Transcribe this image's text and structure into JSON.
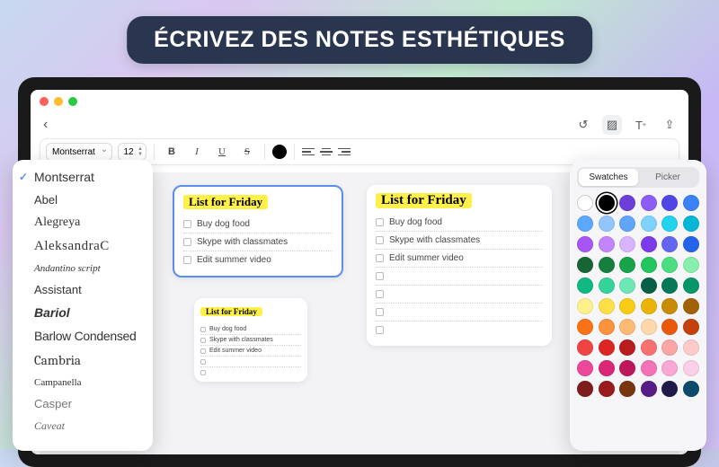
{
  "hero": "ÉCRIVEZ DES NOTES ESTHÉTIQUES",
  "toolbar": {
    "font": "Montserrat",
    "size": "12"
  },
  "fonts": [
    "Montserrat",
    "Abel",
    "Alegreya",
    "AleksandraC",
    "Andantino script",
    "Assistant",
    "Bariol",
    "Barlow Condensed",
    "Cambria",
    "Campanella",
    "Casper",
    "Caveat"
  ],
  "note": {
    "title": "List for Friday",
    "items": [
      "Buy dog food",
      "Skype with classmates",
      "Edit summer video"
    ]
  },
  "picker": {
    "tabs": [
      "Swatches",
      "Picker"
    ],
    "colors": [
      "#ffffff",
      "#000000",
      "#6b3fd9",
      "#8b5cf6",
      "#4f46e5",
      "#3b82f6",
      "#5ba8ff",
      "#93c5fd",
      "#60a5fa",
      "#7dd3fc",
      "#22d3ee",
      "#06b6d4",
      "#a855f7",
      "#c084fc",
      "#d8b4fe",
      "#7c3aed",
      "#6366f1",
      "#2563eb",
      "#166534",
      "#15803d",
      "#16a34a",
      "#22c55e",
      "#4ade80",
      "#86efac",
      "#10b981",
      "#34d399",
      "#6ee7b7",
      "#065f46",
      "#047857",
      "#059669",
      "#fef08a",
      "#fde047",
      "#facc15",
      "#eab308",
      "#ca8a04",
      "#a16207",
      "#f97316",
      "#fb923c",
      "#fdba74",
      "#fed7aa",
      "#ea580c",
      "#c2410c",
      "#ef4444",
      "#dc2626",
      "#b91c1c",
      "#f87171",
      "#fca5a5",
      "#fecaca",
      "#ec4899",
      "#db2777",
      "#be185d",
      "#f472b6",
      "#f9a8d4",
      "#fbcfe8",
      "#7f1d1d",
      "#991b1b",
      "#78350f",
      "#581c87",
      "#1e1b4b",
      "#0c4a6e"
    ]
  }
}
